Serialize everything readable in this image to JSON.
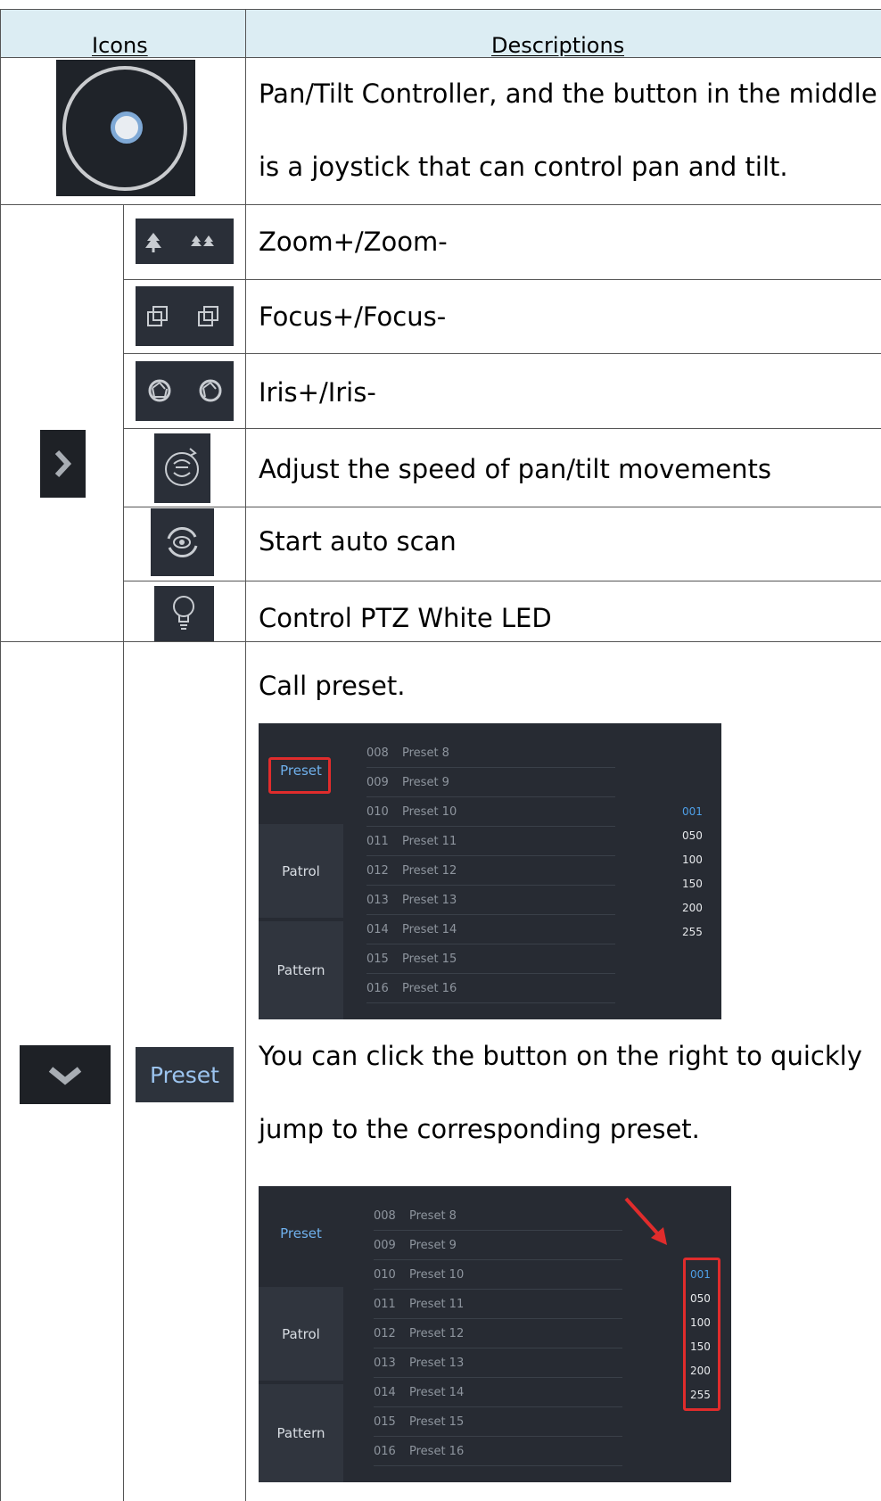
{
  "header": {
    "icons": "Icons",
    "descriptions": "Descriptions"
  },
  "rows": {
    "pan_tilt": {
      "icon": "joystick-icon",
      "line1": "Pan/Tilt Controller, and the button in the middle",
      "line2": "is a joystick that can control pan and tilt."
    },
    "zoom": {
      "icon": "zoom-icon",
      "text": "Zoom+/Zoom-"
    },
    "focus": {
      "icon": "focus-icon",
      "text": "Focus+/Focus-"
    },
    "iris": {
      "icon": "iris-icon",
      "text": "Iris+/Iris-"
    },
    "speed": {
      "icon": "speed-icon",
      "text": "Adjust the speed of pan/tilt movements"
    },
    "scan": {
      "icon": "auto-scan-icon",
      "text": "Start auto scan"
    },
    "led": {
      "icon": "light-bulb-icon",
      "text": "Control PTZ White LED"
    },
    "preset": {
      "button_label": "Preset",
      "call_text": "Call preset.",
      "jump_line1": "You can click the button on the right to quickly",
      "jump_line2": "jump to the corresponding preset."
    }
  },
  "screenshot": {
    "tabs": [
      "Preset",
      "Patrol",
      "Pattern"
    ],
    "presets": [
      {
        "num": "008",
        "name": "Preset 8"
      },
      {
        "num": "009",
        "name": "Preset 9"
      },
      {
        "num": "010",
        "name": "Preset 10"
      },
      {
        "num": "011",
        "name": "Preset 11"
      },
      {
        "num": "012",
        "name": "Preset 12"
      },
      {
        "num": "013",
        "name": "Preset 13"
      },
      {
        "num": "014",
        "name": "Preset 14"
      },
      {
        "num": "015",
        "name": "Preset 15"
      },
      {
        "num": "016",
        "name": "Preset 16"
      }
    ],
    "jump_buttons": [
      "001",
      "050",
      "100",
      "150",
      "200",
      "255"
    ],
    "highlight_color": "#e02c2c",
    "selected_color": "#6fb0ec"
  }
}
